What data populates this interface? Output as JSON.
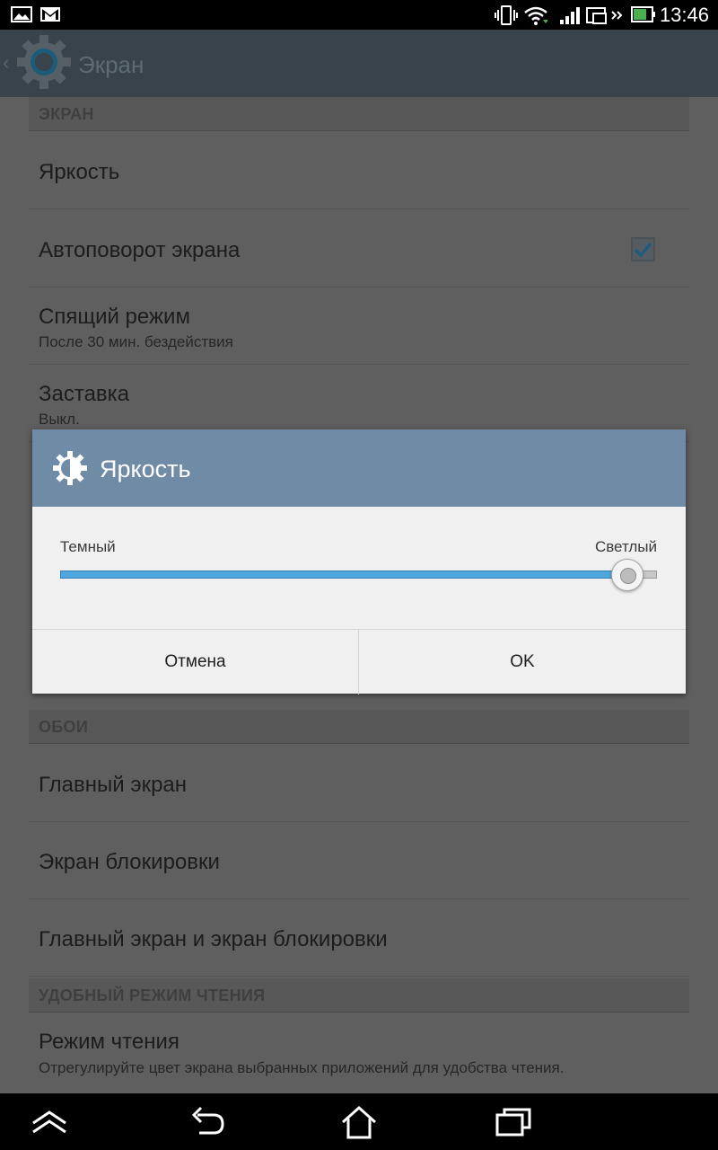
{
  "status_bar": {
    "time": "13:46",
    "icons": [
      "gallery-icon",
      "gmail-icon",
      "vibrate-icon",
      "wifi-icon",
      "signal-icon",
      "screen-mirror-icon",
      "battery-icon"
    ]
  },
  "action_bar": {
    "title": "Экран",
    "icon": "settings-gear-icon"
  },
  "sections": {
    "screen": {
      "header": "ЭКРАН",
      "brightness": "Яркость",
      "autorotate": "Автоповорот экрана",
      "autorotate_checked": true,
      "sleep_title": "Спящий режим",
      "sleep_sub": "После 30 мин. бездействия",
      "daydream_title": "Заставка",
      "daydream_sub": "Выкл."
    },
    "wallpaper": {
      "header": "ОБОИ",
      "home": "Главный экран",
      "lock": "Экран блокировки",
      "home_and_lock": "Главный экран и экран блокировки"
    },
    "reading": {
      "header": "УДОБНЫЙ РЕЖИМ ЧТЕНИЯ",
      "mode_title": "Режим чтения",
      "mode_sub": "Отрегулируйте цвет экрана выбранных приложений для удобства чтения."
    }
  },
  "dialog": {
    "title": "Яркость",
    "icon": "brightness-icon",
    "label_dark": "Темный",
    "label_light": "Светлый",
    "brightness_level": 0.95,
    "cancel": "Отмена",
    "ok": "OK"
  },
  "nav_bar": {
    "icons": [
      "hide-keyboard-icon",
      "back-icon",
      "home-icon",
      "recent-apps-icon"
    ]
  }
}
